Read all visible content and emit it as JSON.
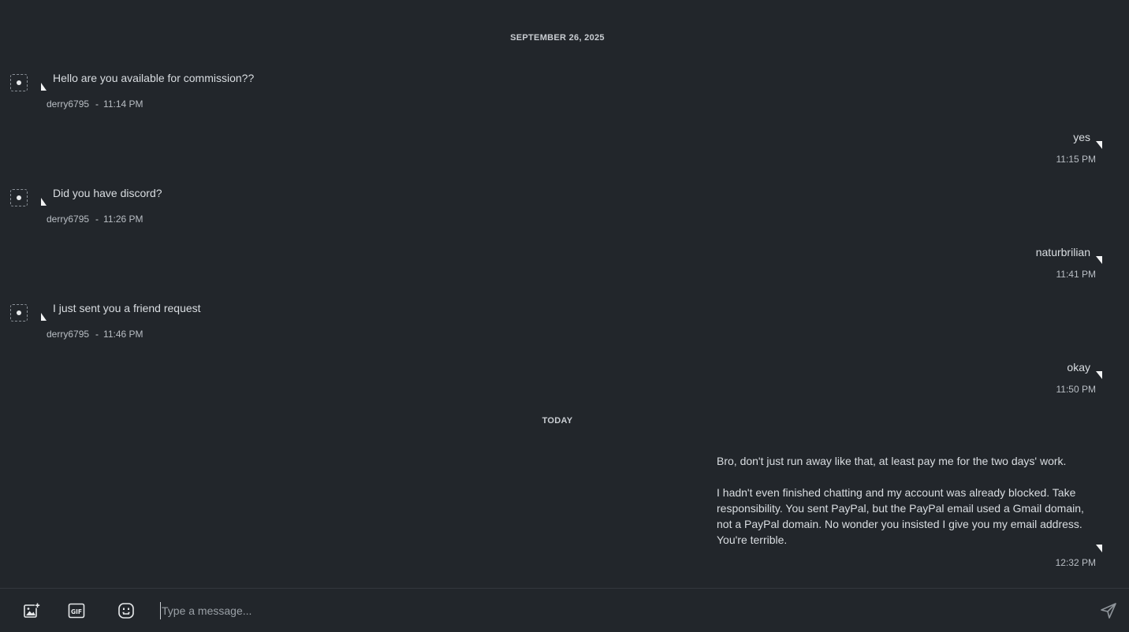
{
  "conversation": {
    "separators": [
      "SEPTEMBER 26, 2025",
      "TODAY"
    ],
    "messages": [
      {
        "side": "left",
        "text": "Hello are you available for commission??",
        "author": "derry6795",
        "time": "11:14 PM"
      },
      {
        "side": "right",
        "text": "yes",
        "time": "11:15 PM"
      },
      {
        "side": "left",
        "text": "Did you have discord?",
        "author": "derry6795",
        "time": "11:26 PM"
      },
      {
        "side": "right",
        "text": "naturbrilian",
        "time": "11:41 PM"
      },
      {
        "side": "left",
        "text": "I just sent you a friend request",
        "author": "derry6795",
        "time": "11:46 PM"
      },
      {
        "side": "right",
        "text": "okay",
        "time": "11:50 PM"
      },
      {
        "side": "right",
        "paragraphs": [
          "Bro, don't just run away like that, at least pay me for the two days' work.",
          "I hadn't even finished chatting and my account was already blocked. Take responsibility. You sent PayPal, but the PayPal email used a Gmail domain, not a PayPal domain. No wonder you insisted I give you my email address. You're terrible."
        ],
        "time": "12:32 PM"
      }
    ],
    "dash": "-"
  },
  "composer": {
    "placeholder": "Type a message...",
    "value": "",
    "icons": [
      "add-image-icon",
      "gif-icon",
      "emoji-icon",
      "send-icon"
    ],
    "gif_label": "GIF"
  },
  "colors": {
    "background": "#22262b",
    "text": "#d9dde1",
    "muted": "#b9bec4"
  }
}
